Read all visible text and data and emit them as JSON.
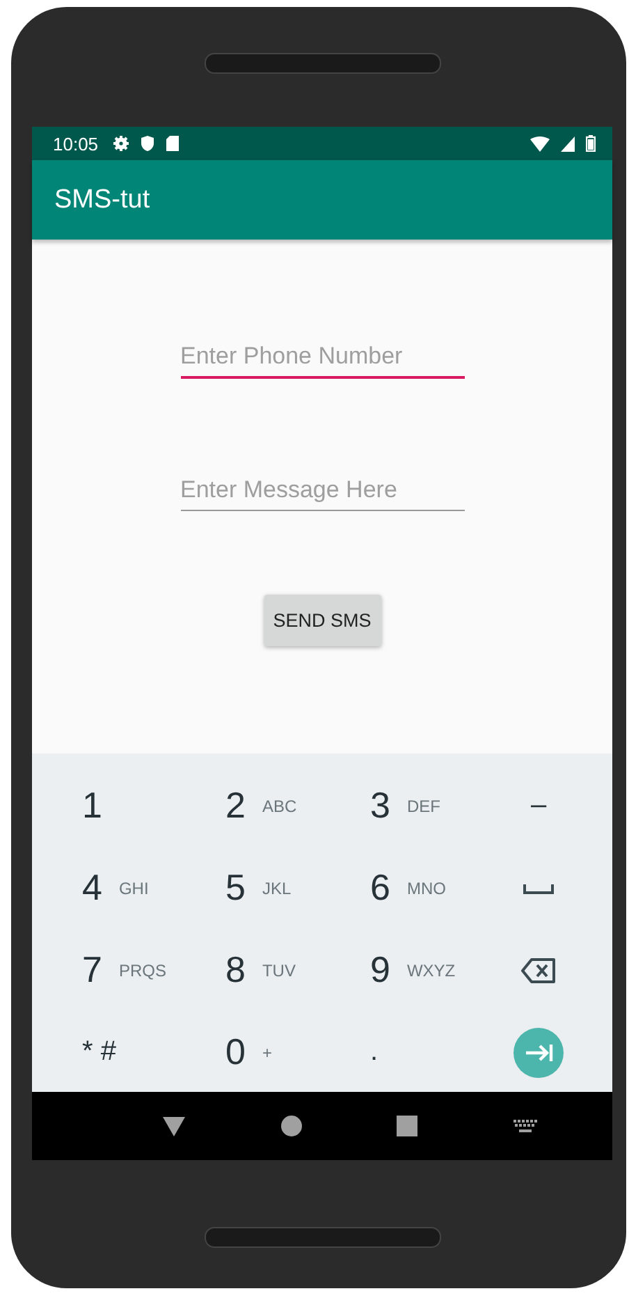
{
  "status_bar": {
    "time": "10:05"
  },
  "app_bar": {
    "title": "SMS-tut"
  },
  "fields": [
    {
      "placeholder": "Enter Phone Number",
      "focused": true
    },
    {
      "placeholder": "Enter Message Here",
      "focused": false
    }
  ],
  "send_button": {
    "label": "SEND SMS"
  },
  "keyboard": {
    "keys": [
      {
        "kind": "digit",
        "main": "1"
      },
      {
        "kind": "digit",
        "main": "2",
        "letters": "ABC"
      },
      {
        "kind": "digit",
        "main": "3",
        "letters": "DEF"
      },
      {
        "kind": "symbol",
        "main": "–"
      },
      {
        "kind": "digit",
        "main": "4",
        "letters": "GHI"
      },
      {
        "kind": "digit",
        "main": "5",
        "letters": "JKL"
      },
      {
        "kind": "digit",
        "main": "6",
        "letters": "MNO"
      },
      {
        "kind": "space"
      },
      {
        "kind": "digit",
        "main": "7",
        "letters": "PRQS"
      },
      {
        "kind": "digit",
        "main": "8",
        "letters": "TUV"
      },
      {
        "kind": "digit",
        "main": "9",
        "letters": "WXYZ"
      },
      {
        "kind": "backspace"
      },
      {
        "kind": "symbol",
        "main": "* #"
      },
      {
        "kind": "digit",
        "main": "0",
        "letters": "+"
      },
      {
        "kind": "symbol",
        "main": "."
      },
      {
        "kind": "enter"
      }
    ]
  }
}
